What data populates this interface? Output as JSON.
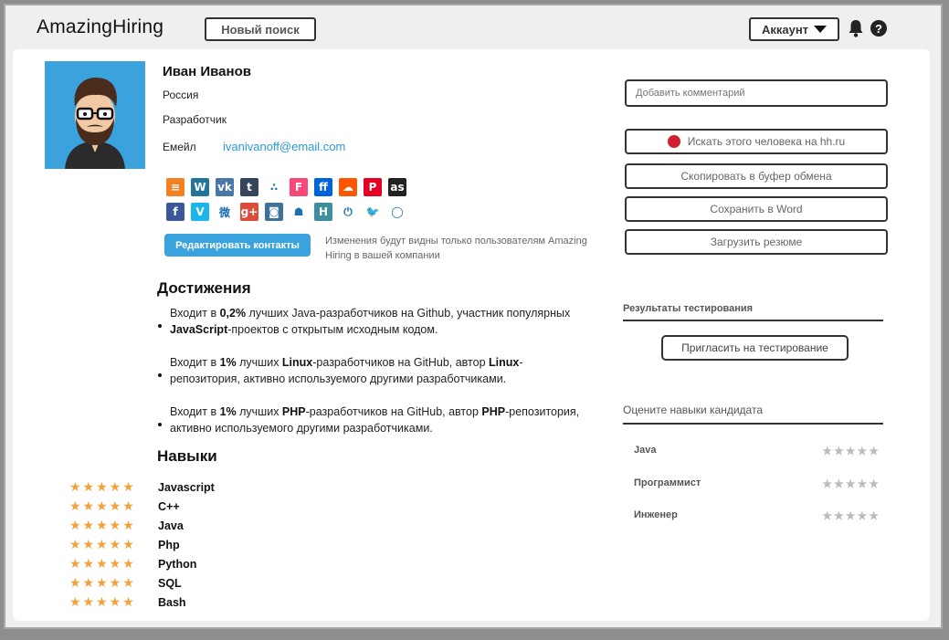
{
  "app": {
    "logo": "AmazingHiring",
    "new_search_label": "Новый поиск",
    "account_label": "Аккаунт",
    "help_label": "?"
  },
  "profile": {
    "name": "Иван Иванов",
    "country": "Россия",
    "role": "Разработчик",
    "email_label": "Емейл",
    "email": "ivanivanoff@email.com",
    "social_icons": [
      {
        "name": "stackoverflow-icon",
        "color": "#f48024",
        "glyph": "≡"
      },
      {
        "name": "wordpress-icon",
        "color": "#21759b",
        "glyph": "W"
      },
      {
        "name": "vk-icon",
        "color": "#4a76a8",
        "glyph": "vk"
      },
      {
        "name": "tumblr-icon",
        "color": "#35465c",
        "glyph": "t"
      },
      {
        "name": "dots-icon",
        "color": "#ffffff",
        "glyph": "∴"
      },
      {
        "name": "foursquare-icon",
        "color": "#f94877",
        "glyph": "F"
      },
      {
        "name": "flickr-icon",
        "color": "#0063dc",
        "glyph": "ff"
      },
      {
        "name": "soundcloud-icon",
        "color": "#ff5500",
        "glyph": "☁"
      },
      {
        "name": "pinterest-icon",
        "color": "#e60023",
        "glyph": "P"
      },
      {
        "name": "lastfm-icon",
        "color": "#222222",
        "glyph": "as"
      }
    ],
    "social_icons_row2": [
      {
        "name": "facebook-icon",
        "color": "#3b5998",
        "glyph": "f"
      },
      {
        "name": "vimeo-icon",
        "color": "#1ab7ea",
        "glyph": "V"
      },
      {
        "name": "weibo-icon",
        "color": "#ffffff",
        "glyph": "微"
      },
      {
        "name": "google-plus-icon",
        "color": "#dd4b39",
        "glyph": "g+"
      },
      {
        "name": "instagram-icon",
        "color": "#3f729b",
        "glyph": "◙"
      },
      {
        "name": "cat-icon",
        "color": "#ffffff",
        "glyph": "☗"
      },
      {
        "name": "habr-icon",
        "color": "#3e8e9d",
        "glyph": "H"
      },
      {
        "name": "power-icon",
        "color": "#ffffff",
        "glyph": "⏻"
      },
      {
        "name": "twitter-icon",
        "color": "#ffffff",
        "glyph": "🐦"
      },
      {
        "name": "github-icon",
        "color": "#ffffff",
        "glyph": "◯"
      }
    ],
    "edit_contacts_label": "Редактировать контакты",
    "edit_note": "Изменения будут видны только пользователям Amazing Hiring в вашей компании"
  },
  "achievements": {
    "title": "Достижения",
    "items": [
      {
        "pre": "Входит в ",
        "b1": "0,2%",
        "mid": " лучших Java-разработчиков на Github, участник популярных ",
        "b2": "JavaScript",
        "post": "-проектов с открытым исходным кодом."
      },
      {
        "pre": "Входит в ",
        "b1": "1%",
        "mid": " лучших ",
        "b2": "Linux",
        "post": "-разработчиков на GitHub, автор ",
        "b3": "Linux",
        "post2": "-репозитория, активно используемого другими разработчиками."
      },
      {
        "pre": "Входит в ",
        "b1": "1%",
        "mid": " лучших ",
        "b2": "PHP",
        "post": "-разработчиков на GitHub, автор ",
        "b3": "PHP",
        "post2": "-репозитория, активно используемого другими разработчиками."
      }
    ]
  },
  "skills": {
    "title": "Навыки",
    "items": [
      {
        "label": "Javascript",
        "rating": 5
      },
      {
        "label": "C++",
        "rating": 5
      },
      {
        "label": "Java",
        "rating": 5
      },
      {
        "label": "Php",
        "rating": 5
      },
      {
        "label": "Python",
        "rating": 5
      },
      {
        "label": "SQL",
        "rating": 5
      },
      {
        "label": "Bash",
        "rating": 5
      }
    ]
  },
  "actions": {
    "comment_placeholder": "Добавить комментарий",
    "search_hh": "Искать этого человека на hh.ru",
    "copy": "Скопировать в буфер обмена",
    "save_word": "Сохранить в Word",
    "upload_resume": "Загрузить резюме"
  },
  "testing": {
    "title": "Результаты тестирования",
    "invite": "Пригласить на тестирование"
  },
  "rating": {
    "title": "Оцените навыки кандидата",
    "rows": [
      {
        "label": "Java",
        "stars": "★★★★★"
      },
      {
        "label": "Программист",
        "stars": "★★★★★"
      },
      {
        "label": "Инженер",
        "stars": "★★★★★"
      }
    ]
  },
  "colors": {
    "accent": "#3aa3dd",
    "star": "#f2a23a",
    "record": "#d02030"
  }
}
